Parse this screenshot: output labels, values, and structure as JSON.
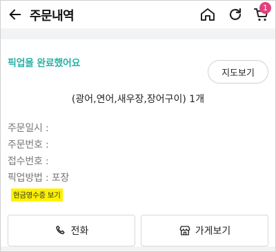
{
  "header": {
    "title": "주문내역",
    "back_icon": "arrow-left-icon",
    "home_icon": "home-icon",
    "refresh_icon": "refresh-icon",
    "cart_icon": "cart-icon",
    "cart_count": "1",
    "badge_color": "#e0407b"
  },
  "order": {
    "status": "픽업을 완료했어요",
    "status_color": "#2ab3a8",
    "map_button": "지도보기",
    "items_summary": "(광어,연어,새우장,장어구이) 1개",
    "details": [
      {
        "label": "주문일시 :",
        "value": ""
      },
      {
        "label": "주문번호 :",
        "value": ""
      },
      {
        "label": "접수번호 :",
        "value": ""
      },
      {
        "label": "픽업방법 :",
        "value": "포장"
      }
    ],
    "receipt_link": "현금영수증 보기",
    "highlight_color": "#fff200"
  },
  "actions": {
    "call_label": "전화",
    "call_icon": "phone-icon",
    "store_label": "가게보기",
    "store_icon": "store-icon"
  }
}
